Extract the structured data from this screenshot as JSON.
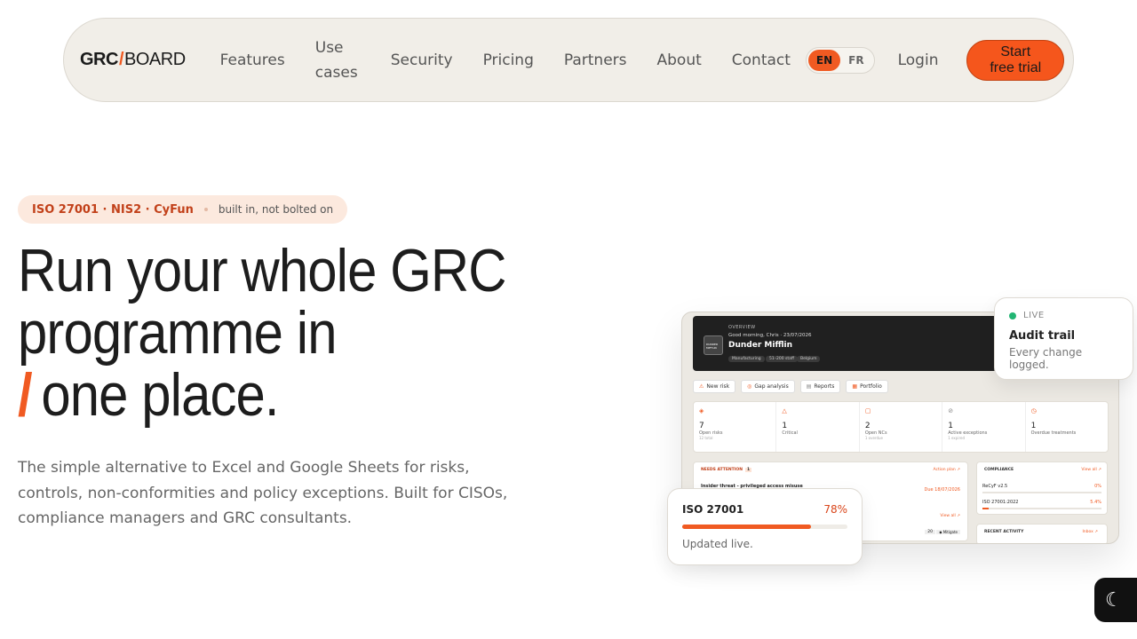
{
  "nav": {
    "logo_a": "GRC",
    "logo_slash": "/",
    "logo_b": "BOARD",
    "links": [
      "Features",
      "Use cases",
      "Security",
      "Pricing",
      "Partners",
      "About",
      "Contact"
    ],
    "lang": [
      "EN",
      "FR"
    ],
    "lang_active": "EN",
    "login": "Login",
    "cta": "Start free trial"
  },
  "badge": {
    "main": "ISO 27001 · NIS2 · CyFun",
    "sub": "built in, not bolted on"
  },
  "hero": {
    "line1": "Run your whole GRC",
    "line2": "programme in",
    "slash": "/",
    "line3": "one place.",
    "description": "The simple alternative to Excel and Google Sheets for risks, controls, non-conformities and policy exceptions. Built for CISOs, compliance managers and GRC consultants."
  },
  "dashboard": {
    "overview": "OVERVIEW",
    "greeting": "Good morning, Chris · 23/07/2026",
    "company": "Dunder Mifflin",
    "avatar": "DUNDER MIFFLIN",
    "chips": [
      "Manufacturing",
      "51–200 staff",
      "Belgium"
    ],
    "actions": [
      "New risk",
      "Gap analysis",
      "Reports",
      "Portfolio"
    ],
    "stats": [
      {
        "value": "7",
        "label": "Open risks",
        "sub": "12 total"
      },
      {
        "value": "1",
        "label": "Critical",
        "sub": ""
      },
      {
        "value": "2",
        "label": "Open NCs",
        "sub": "1 overdue"
      },
      {
        "value": "1",
        "label": "Active exceptions",
        "sub": "1 expired"
      },
      {
        "value": "1",
        "label": "Overdue treatments",
        "sub": ""
      }
    ],
    "attention_title": "NEEDS ATTENTION",
    "attention_count": "1",
    "attention_link": "Action plan ↗",
    "attention_item": "Insider threat - privileged access misuse",
    "attention_due": "Due 18/07/2026",
    "view_all": "View all ↗",
    "badge_20": "20",
    "mitigate": "◆ Mitigate",
    "compliance_title": "COMPLIANCE",
    "compliance_link": "View all ↗",
    "compliance_rows": [
      {
        "name": "ReCyF v2.5",
        "pct": "0%",
        "value": 0
      },
      {
        "name": "ISO 27001:2022",
        "pct": "5.4%",
        "value": 5.4
      }
    ],
    "activity_title": "RECENT ACTIVITY",
    "activity_link": "Inbox ↗"
  },
  "audit": {
    "live": "LIVE",
    "title": "Audit trail",
    "sub": "Every change logged."
  },
  "iso": {
    "name": "ISO 27001",
    "pct": "78%",
    "value": 78,
    "sub": "Updated live."
  },
  "theme_icon": "moon-icon",
  "colors": {
    "accent": "#f05a22",
    "nav_bg": "#f1eee8",
    "live": "#22b573"
  }
}
